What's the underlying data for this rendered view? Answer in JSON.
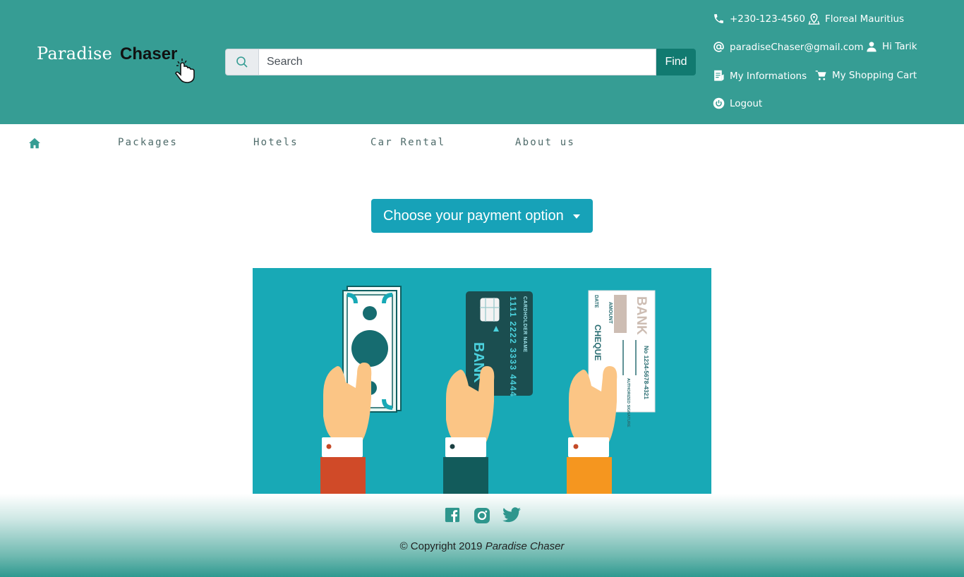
{
  "brand": {
    "part1": "Paradise",
    "part2": "Chaser"
  },
  "search": {
    "placeholder": "Search",
    "button": "Find"
  },
  "contact": {
    "phone": "+230-123-4560",
    "location": "Floreal Mauritius",
    "email": "paradiseChaser@gmail.com",
    "greeting": "Hi Tarik",
    "my_info": "My Informations",
    "cart": "My Shopping Cart",
    "logout": "Logout"
  },
  "nav": {
    "items": [
      "Packages",
      "Hotels",
      "Car Rental",
      "About us"
    ]
  },
  "payment": {
    "dropdown_label": "Choose your payment option"
  },
  "illustration": {
    "card_number": "1111 2222 3333 4444",
    "card_bank": "BANK",
    "card_holder": "CARDHOLDER NAME",
    "cheque_title": "CHEQUE",
    "cheque_bank": "BANK",
    "cheque_date": "DATE",
    "cheque_amount": "AMOUNT",
    "cheque_signature": "AUTHORIZED SIGNATURE",
    "cheque_number": "No 1234-5678-4321"
  },
  "footer": {
    "copyright_prefix": "© Copyright 2019",
    "copyright_name": "Paradise Chaser"
  },
  "colors": {
    "header": "#369d94",
    "accent": "#17a2b8",
    "find_button": "#117a70"
  }
}
